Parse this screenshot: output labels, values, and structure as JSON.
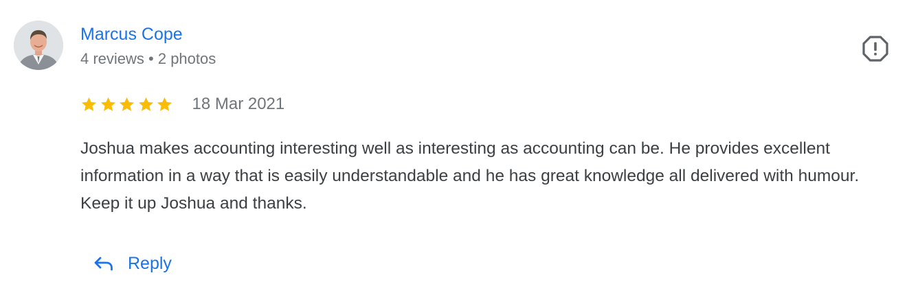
{
  "review": {
    "author": {
      "name": "Marcus Cope",
      "meta": "4 reviews • 2 photos",
      "avatar_icon": "person-photo-avatar"
    },
    "rating": {
      "stars": 5,
      "max_stars": 5,
      "star_color": "#fbbc04"
    },
    "date": "18 Mar 2021",
    "text": "Joshua makes accounting interesting well as interesting as accounting can be. He provides excellent information in a way that is easily understandable and he has great knowledge all delivered with humour. Keep it up Joshua and thanks.",
    "actions": {
      "report_icon": "report-octagon-icon",
      "reply_icon": "reply-arrow-icon",
      "reply_label": "Reply"
    }
  },
  "colors": {
    "link_blue": "#1a73e8",
    "secondary_text": "#70757a",
    "body_text": "#3c4043"
  }
}
